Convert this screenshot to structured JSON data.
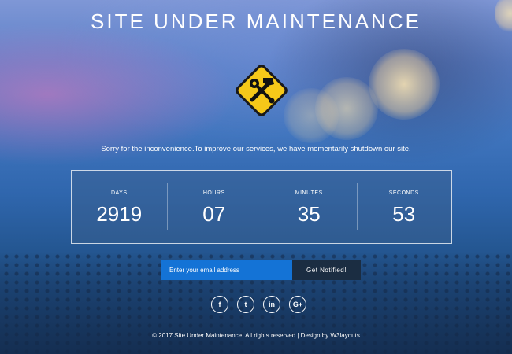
{
  "page": {
    "title": "SITE UNDER MAINTENANCE",
    "message": "Sorry for the inconvenience.To improve our services, we have momentarily shutdown our site."
  },
  "countdown": [
    {
      "label": "DAYS",
      "value": "2919"
    },
    {
      "label": "HOURS",
      "value": "07"
    },
    {
      "label": "MINUTES",
      "value": "35"
    },
    {
      "label": "SECONDS",
      "value": "53"
    }
  ],
  "subscribe": {
    "placeholder": "Enter your email address",
    "button_label": "Get Notified!"
  },
  "social": [
    {
      "icon": "facebook-icon",
      "glyph": "f"
    },
    {
      "icon": "twitter-icon",
      "glyph": "t"
    },
    {
      "icon": "linkedin-icon",
      "glyph": "in"
    },
    {
      "icon": "google-plus-icon",
      "glyph": "G+"
    }
  ],
  "footer": {
    "text": "© 2017 Site Under Maintenance. All rights reserved | Design by W3layouts"
  },
  "colors": {
    "email_field": "#1473d6",
    "notify_button": "#1b2d42",
    "sign_yellow": "#f6c819"
  }
}
